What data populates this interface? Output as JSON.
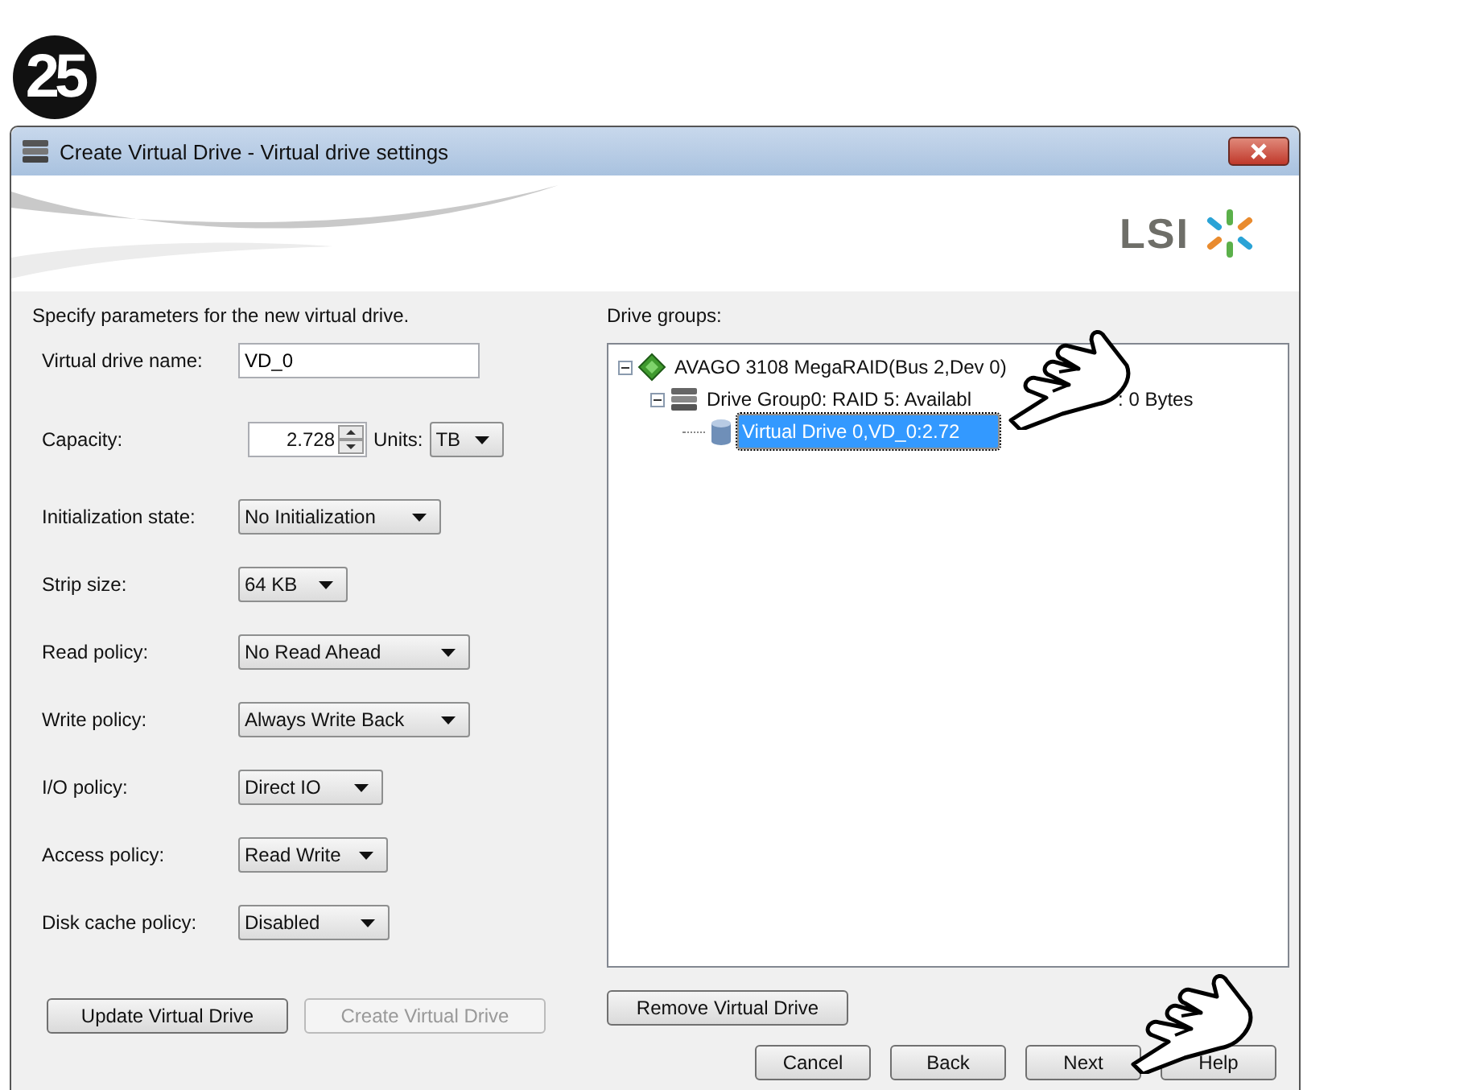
{
  "step": "25",
  "window": {
    "title": "Create Virtual Drive - Virtual drive settings"
  },
  "logo": "LSI",
  "form": {
    "intro": "Specify parameters for the new virtual drive.",
    "fields": [
      {
        "kind": "text",
        "label": "Virtual drive name:",
        "value": "VD_0"
      },
      {
        "kind": "spinner",
        "label": "Capacity:",
        "value": "2.728",
        "units_label": "Units:",
        "units": "TB"
      },
      {
        "kind": "select",
        "label": "Initialization state:",
        "value": "No Initialization"
      },
      {
        "kind": "select",
        "label": "Strip size:",
        "value": "64 KB"
      },
      {
        "kind": "select",
        "label": "Read policy:",
        "value": "No Read Ahead"
      },
      {
        "kind": "select",
        "label": "Write policy:",
        "value": "Always Write Back"
      },
      {
        "kind": "select",
        "label": "I/O policy:",
        "value": "Direct IO"
      },
      {
        "kind": "select",
        "label": "Access policy:",
        "value": "Read Write"
      },
      {
        "kind": "select",
        "label": "Disk cache policy:",
        "value": "Disabled"
      }
    ]
  },
  "drive_groups": {
    "label": "Drive groups:",
    "tree": [
      {
        "kind": "controller",
        "text": "AVAGO 3108 MegaRAID(Bus 2,Dev 0)",
        "expanded": true,
        "selected": false,
        "children": [
          {
            "kind": "group",
            "text": "Drive Group0: RAID  5: Availabl",
            "text_after": ": 0 Bytes",
            "expanded": true,
            "selected": false,
            "children": [
              {
                "kind": "virtual",
                "text": "Virtual Drive 0,VD_0:2.72",
                "selected": true
              }
            ]
          }
        ]
      }
    ]
  },
  "actions": [
    {
      "label": "Update Virtual Drive",
      "disabled": false
    },
    {
      "label": "Create Virtual Drive",
      "disabled": true
    }
  ],
  "remove_button": {
    "label": "Remove Virtual Drive",
    "disabled": false
  },
  "nav_buttons": [
    {
      "label": "Cancel"
    },
    {
      "label": "Back"
    },
    {
      "label": "Next"
    },
    {
      "label": "Help"
    }
  ]
}
